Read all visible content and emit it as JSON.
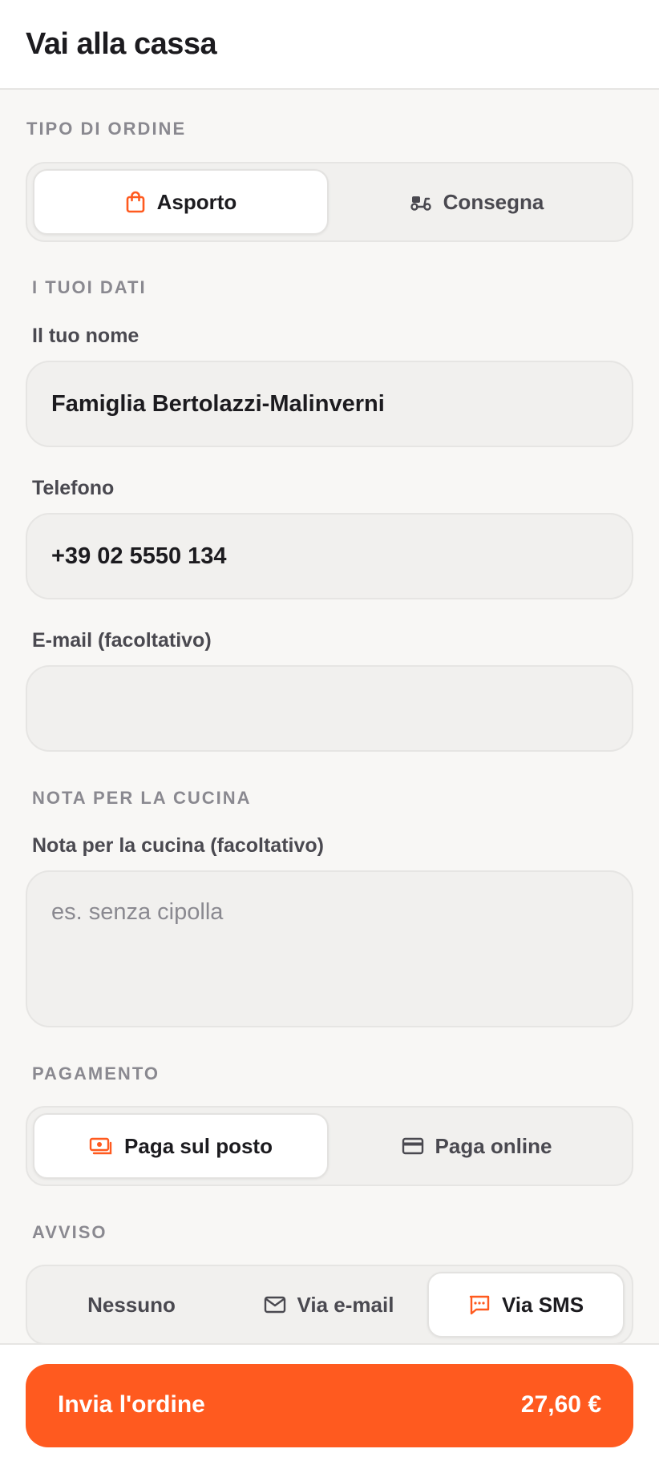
{
  "header": {
    "title": "Vai alla cassa"
  },
  "order_type": {
    "label": "TIPO DI ORDINE",
    "options": [
      {
        "label": "Asporto",
        "icon": "shopping-bag-icon",
        "selected": true
      },
      {
        "label": "Consegna",
        "icon": "scooter-icon",
        "selected": false
      }
    ]
  },
  "details": {
    "label": "I TUOI DATI",
    "name": {
      "label": "Il tuo nome",
      "value": "Famiglia Bertolazzi-Malinverni"
    },
    "phone": {
      "label": "Telefono",
      "value": "+39 02 5550 134"
    },
    "email": {
      "label": "E-mail (facoltativo)",
      "value": ""
    }
  },
  "kitchen_note": {
    "label": "NOTA PER LA CUCINA",
    "field_label": "Nota per la cucina (facoltativo)",
    "placeholder": "es. senza cipolla"
  },
  "payment": {
    "label": "PAGAMENTO",
    "options": [
      {
        "label": "Paga sul posto",
        "icon": "cash-icon",
        "selected": true
      },
      {
        "label": "Paga online",
        "icon": "credit-card-icon",
        "selected": false
      }
    ]
  },
  "notice": {
    "label": "AVVISO",
    "options": [
      {
        "label": "Nessuno",
        "selected": false
      },
      {
        "label": "Via e-mail",
        "icon": "mail-icon",
        "selected": false
      },
      {
        "label": "Via SMS",
        "icon": "chat-icon",
        "selected": true
      }
    ]
  },
  "footer": {
    "submit_label": "Invia l'ordine",
    "total": "27,60 €"
  },
  "colors": {
    "accent": "#ff5a1f",
    "background": "#f8f7f5",
    "text": "#1c1b1f",
    "muted": "#8a8990"
  }
}
